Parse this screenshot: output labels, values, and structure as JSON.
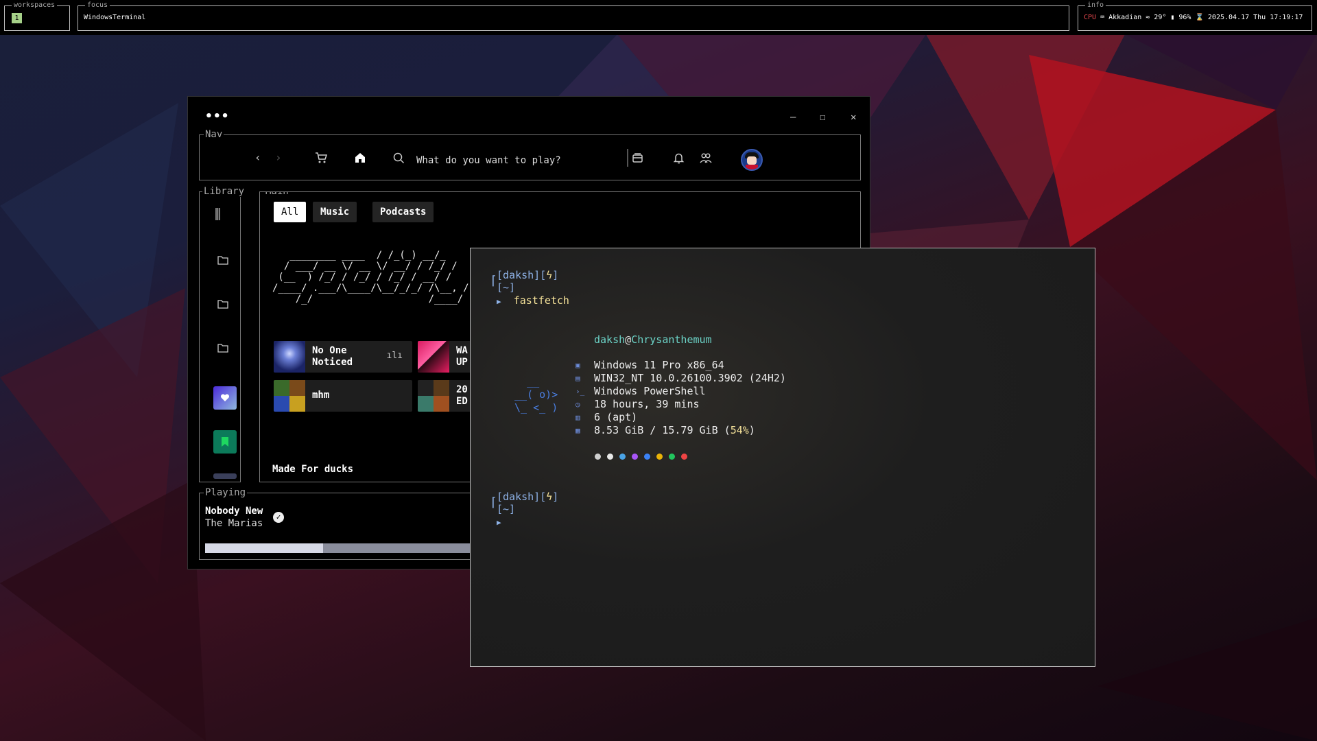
{
  "topbar": {
    "workspaces_label": "workspaces",
    "workspace_number": "1",
    "focus_label": "focus",
    "focus_title": "WindowsTerminal",
    "info_label": "info",
    "cpu": "CPU",
    "keyboard": "Akkadian",
    "temperature": "29°",
    "battery": "96%",
    "datetime": "2025.04.17 Thu 17:19:17"
  },
  "spotify": {
    "menu_dots": "•••",
    "nav_legend": "Nav",
    "search_placeholder": "What do you want to play?",
    "library_legend": "Library",
    "main_legend": "Main",
    "chips": [
      "All",
      "Music",
      "Podcasts"
    ],
    "ascii_art": "   ________ ____  / /_(_) __/_\n  / ___/ __ \\/ __ \\/ __/ / /_/ /\n (__  ) /_/ / /_/ / /_/ / __/ /\n/____/ .___/\\____/\\__/_/_/ /\\__, /\n    /_/                    /____/",
    "cards": [
      {
        "title_line1": "No One",
        "title_line2": "Noticed"
      },
      {
        "title_line1": "WA",
        "title_line2": "UP"
      },
      {
        "title_line1": "mhm",
        "title_line2": ""
      },
      {
        "title_line1": "20",
        "title_line2": "ED"
      }
    ],
    "made_for": "Made For ducks",
    "playing_legend": "Playing",
    "now_playing": {
      "title": "Nobody New",
      "artist": "The Marias",
      "progress": 0.2
    }
  },
  "terminal": {
    "prompt1_user": "[daksh][",
    "prompt1_bolt": "ϟ",
    "prompt1_close": "]",
    "prompt1_dir": "[~]",
    "arrow": "▶",
    "command": "fastfetch",
    "user": "daksh",
    "at": "@",
    "host": "Chrysanthemum",
    "logo": "   __\n __( o)>\n \\_ <_ )",
    "info": [
      {
        "icon": "windows-icon",
        "text": "Windows 11 Pro x86_64"
      },
      {
        "icon": "kernel-icon",
        "text": "WIN32_NT 10.0.26100.3902 (24H2)"
      },
      {
        "icon": "shell-icon",
        "text": "Windows PowerShell"
      },
      {
        "icon": "clock-icon",
        "text": "18 hours, 39 mins"
      },
      {
        "icon": "package-icon",
        "text": "6 (apt)"
      },
      {
        "icon": "memory-icon",
        "text": "8.53 GiB / 15.79 GiB (",
        "highlight": "54%",
        "suffix": ")"
      }
    ],
    "color_dots": [
      "#cfcfcf",
      "#e8e8e8",
      "#4aa3e6",
      "#a855f7",
      "#3b82f6",
      "#eab308",
      "#22c55e",
      "#ef4444"
    ],
    "prompt2_user": "[daksh][",
    "prompt2_bolt": "ϟ",
    "prompt2_close": "]",
    "prompt2_dir": "[~]"
  }
}
